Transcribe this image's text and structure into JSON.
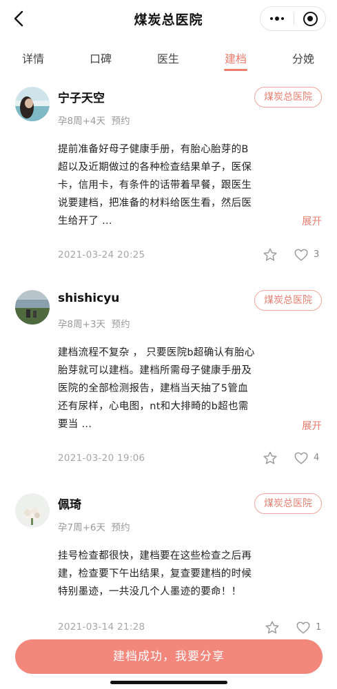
{
  "header": {
    "title": "煤炭总医院",
    "back_icon": "chevron-left-icon",
    "more_icon": "more-dots-icon",
    "close_icon": "target-close-icon"
  },
  "tabs": [
    {
      "label": "详情",
      "active": false
    },
    {
      "label": "口碑",
      "active": false
    },
    {
      "label": "医生",
      "active": false
    },
    {
      "label": "建档",
      "active": true
    },
    {
      "label": "分娩",
      "active": false
    }
  ],
  "accent_color": "#ef7d6c",
  "posts": [
    {
      "username": "宁子天空",
      "hospital_tag": "煤炭总医院",
      "pregnancy": "孕8周+4天",
      "type": "预约",
      "content_lines": [
        "提前准备好母子健康手册，有胎心胎芽的B",
        "超以及近期做过的各种检查结果单子，医保",
        "卡，信用卡，有条件的话带着早餐，跟医生",
        "说要建档，把准备的材料给医生看，然后医",
        "生给开了 ..."
      ],
      "expand_label": "展开",
      "datetime": "2021-03-24 20:25",
      "likes": "3"
    },
    {
      "username": "shishicyu",
      "hospital_tag": "煤炭总医院",
      "pregnancy": "孕8周+3天",
      "type": "预约",
      "content_lines": [
        "建档流程不复杂 ， 只要医院b超确认有胎心",
        "胎芽就可以建档。建档所需母子健康手册及",
        "医院的全部检测报告，建档当天抽了5管血",
        "还有尿样，心电图，nt和大排畸的b超也需",
        "要当 ..."
      ],
      "expand_label": "展开",
      "datetime": "2021-03-20 19:06",
      "likes": "4"
    },
    {
      "username": "佩琦",
      "hospital_tag": "煤炭总医院",
      "pregnancy": "孕7周+6天",
      "type": "预约",
      "content_lines": [
        "挂号检查都很快，建档要在这些检查之后再",
        "建，检查要下午出结果，复查要建档的时候",
        "特别墨迹，一共没几个人墨迹的要命！！"
      ],
      "datetime": "2021-03-14 21:28",
      "likes": "1"
    }
  ],
  "cta_label": "建档成功，我要分享"
}
